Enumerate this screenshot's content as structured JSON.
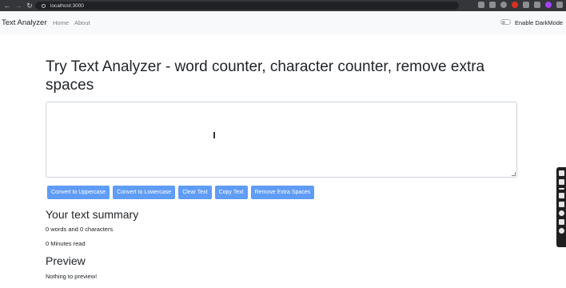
{
  "browser": {
    "url": "localhost:3000"
  },
  "navbar": {
    "brand": "Text Analyzer",
    "links": [
      "Home",
      "About"
    ],
    "toggle_label": "Enable DarkMode"
  },
  "main": {
    "heading": "Try Text Analyzer - word counter, character counter, remove extra spaces",
    "textarea_value": "",
    "buttons": [
      "Convert to Uppercase",
      "Convert to Lowercase",
      "Clear Text",
      "Copy Text",
      "Remove Extra Spaces"
    ],
    "summary": {
      "heading": "Your text summary",
      "counts": "0 words and 0 characters",
      "read_time": "0 Minutes read"
    },
    "preview": {
      "heading": "Preview",
      "text": "Nothing to preview!"
    }
  },
  "colors": {
    "button_bg": "#5f9cf6",
    "navbar_bg": "#f8f9fa",
    "text": "#212529"
  }
}
